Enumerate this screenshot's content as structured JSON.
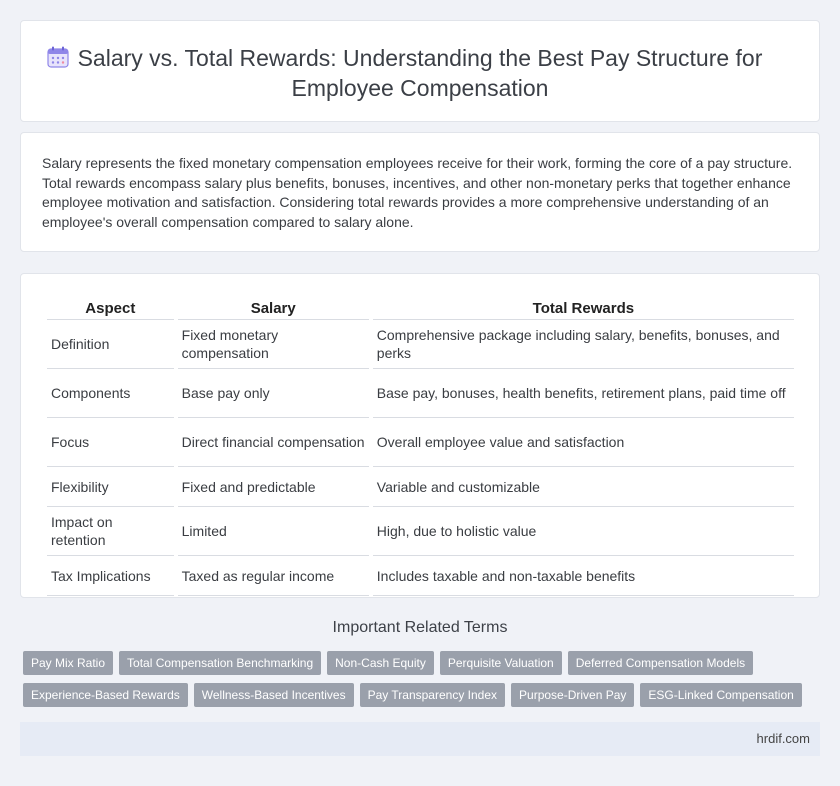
{
  "header": {
    "title": "Salary vs. Total Rewards: Understanding the Best Pay Structure for Employee Compensation",
    "icon": "calendar-icon"
  },
  "intro": {
    "text": "Salary represents the fixed monetary compensation employees receive for their work, forming the core of a pay structure. Total rewards encompass salary plus benefits, bonuses, incentives, and other non-monetary perks that together enhance employee motivation and satisfaction. Considering total rewards provides a more comprehensive understanding of an employee's overall compensation compared to salary alone."
  },
  "table": {
    "headers": [
      "Aspect",
      "Salary",
      "Total Rewards"
    ],
    "rows": [
      [
        "Definition",
        "Fixed monetary compensation",
        "Comprehensive package including salary, benefits, bonuses, and perks"
      ],
      [
        "Components",
        "Base pay only",
        "Base pay, bonuses, health benefits, retirement plans, paid time off"
      ],
      [
        "Focus",
        "Direct financial compensation",
        "Overall employee value and satisfaction"
      ],
      [
        "Flexibility",
        "Fixed and predictable",
        "Variable and customizable"
      ],
      [
        "Impact on retention",
        "Limited",
        "High, due to holistic value"
      ],
      [
        "Tax Implications",
        "Taxed as regular income",
        "Includes taxable and non-taxable benefits"
      ]
    ]
  },
  "related": {
    "title": "Important Related Terms",
    "tags_row1": [
      "Pay Mix Ratio",
      "Total Compensation Benchmarking",
      "Non-Cash Equity",
      "Perquisite Valuation",
      "Deferred Compensation Models"
    ],
    "tags_row2": [
      "Experience-Based Rewards",
      "Wellness-Based Incentives",
      "Pay Transparency Index",
      "Purpose-Driven Pay",
      "ESG-Linked Compensation"
    ]
  },
  "footer": {
    "site": "hrdif.com"
  },
  "colors": {
    "background": "#f0f2f7",
    "tag": "#9aa0ab",
    "footer": "#e6ebf5"
  }
}
